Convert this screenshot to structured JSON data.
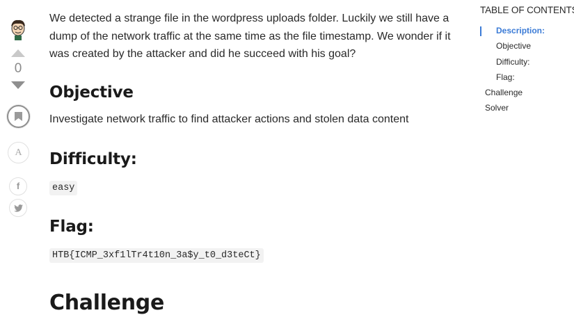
{
  "rail": {
    "vote_count": "0",
    "font_button_label": "A",
    "facebook_label": "f"
  },
  "article": {
    "intro": "We detected a strange file in the wordpress uploads folder. Luckily we still have a dump of the network traffic at the same time as the file timestamp. We wonder if it was created by the attacker and did he succeed with his goal?",
    "objective_heading": "Objective",
    "objective_text": "Investigate network traffic to find attacker actions and stolen data content",
    "difficulty_heading": "Difficulty:",
    "difficulty_value": "easy",
    "flag_heading": "Flag:",
    "flag_value": "HTB{ICMP_3xf1lTr4t10n_3a$y_t0_d3teCt}",
    "challenge_heading": "Challenge"
  },
  "toc": {
    "title": "TABLE OF CONTENTS",
    "items": [
      {
        "label": "Description:",
        "active": true
      },
      {
        "label": "Objective"
      },
      {
        "label": "Difficulty:"
      },
      {
        "label": "Flag:"
      },
      {
        "label": "Challenge"
      },
      {
        "label": "Solver"
      }
    ]
  },
  "colors": {
    "accent": "#3b7bd6",
    "code_bg": "#f2f2f2",
    "vote_up": "#c9c9c9",
    "vote_down": "#8f8f8f"
  }
}
